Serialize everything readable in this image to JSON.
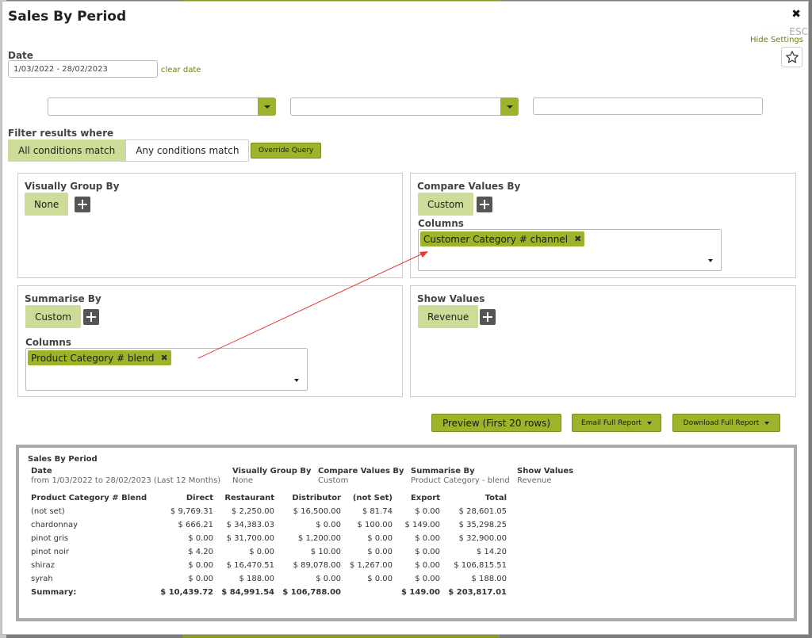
{
  "window": {
    "title": "Sales By Period",
    "close_label": "✖",
    "esc_label": "ESC",
    "hide_settings_label": "Hide Settings"
  },
  "date": {
    "label": "Date",
    "value": "1/03/2022 - 28/02/2023",
    "clear_label": "clear date"
  },
  "filters": {
    "title": "Filter results where",
    "all_label": "All conditions match",
    "any_label": "Any conditions match",
    "override_label": "Override Query"
  },
  "visually_group": {
    "title": "Visually Group By",
    "value": "None"
  },
  "compare_values": {
    "title": "Compare Values By",
    "value": "Custom",
    "columns_label": "Columns",
    "tag": "Customer Category # channel"
  },
  "summarise": {
    "title": "Summarise By",
    "value": "Custom",
    "columns_label": "Columns",
    "tag": "Product Category # blend"
  },
  "show_values": {
    "title": "Show Values",
    "value": "Revenue"
  },
  "actions": {
    "preview_label": "Preview (First 20 rows)",
    "email_label": "Email Full Report",
    "download_label": "Download Full Report"
  },
  "report": {
    "title": "Sales By Period",
    "meta": {
      "date_label": "Date",
      "date_value": "from 1/03/2022 to 28/02/2023 (Last 12 Months)",
      "group_label": "Visually Group By",
      "group_value": "None",
      "compare_label": "Compare Values By",
      "compare_value": "Custom",
      "summarise_label": "Summarise By",
      "summarise_value": "Product Category - blend",
      "show_label": "Show Values",
      "show_value": "Revenue"
    },
    "columns": [
      "Product Category # Blend",
      "Direct",
      "Restaurant",
      "Distributor",
      "(not Set)",
      "Export",
      "Total"
    ],
    "rows": [
      [
        "(not set)",
        "$ 9,769.31",
        "$ 2,250.00",
        "$ 16,500.00",
        "$ 81.74",
        "$ 0.00",
        "$ 28,601.05"
      ],
      [
        "chardonnay",
        "$ 666.21",
        "$ 34,383.03",
        "$ 0.00",
        "$ 100.00",
        "$ 149.00",
        "$ 35,298.25"
      ],
      [
        "pinot gris",
        "$ 0.00",
        "$ 31,700.00",
        "$ 1,200.00",
        "$ 0.00",
        "$ 0.00",
        "$ 32,900.00"
      ],
      [
        "pinot noir",
        "$ 4.20",
        "$ 0.00",
        "$ 10.00",
        "$ 0.00",
        "$ 0.00",
        "$ 14.20"
      ],
      [
        "shiraz",
        "$ 0.00",
        "$ 16,470.51",
        "$ 89,078.00",
        "$ 1,267.00",
        "$ 0.00",
        "$ 106,815.51"
      ],
      [
        "syrah",
        "$ 0.00",
        "$ 188.00",
        "$ 0.00",
        "$ 0.00",
        "$ 0.00",
        "$ 188.00"
      ]
    ],
    "summary": [
      "Summary:",
      "$ 10,439.72",
      "$ 84,991.54",
      "$ 106,788.00",
      "",
      "$ 149.00",
      "$ 203,817.01"
    ]
  },
  "colors": {
    "accent": "#9cb32a",
    "pill": "#cddc98",
    "link": "#6d7f14",
    "annotation_arrow": "#e53935"
  }
}
